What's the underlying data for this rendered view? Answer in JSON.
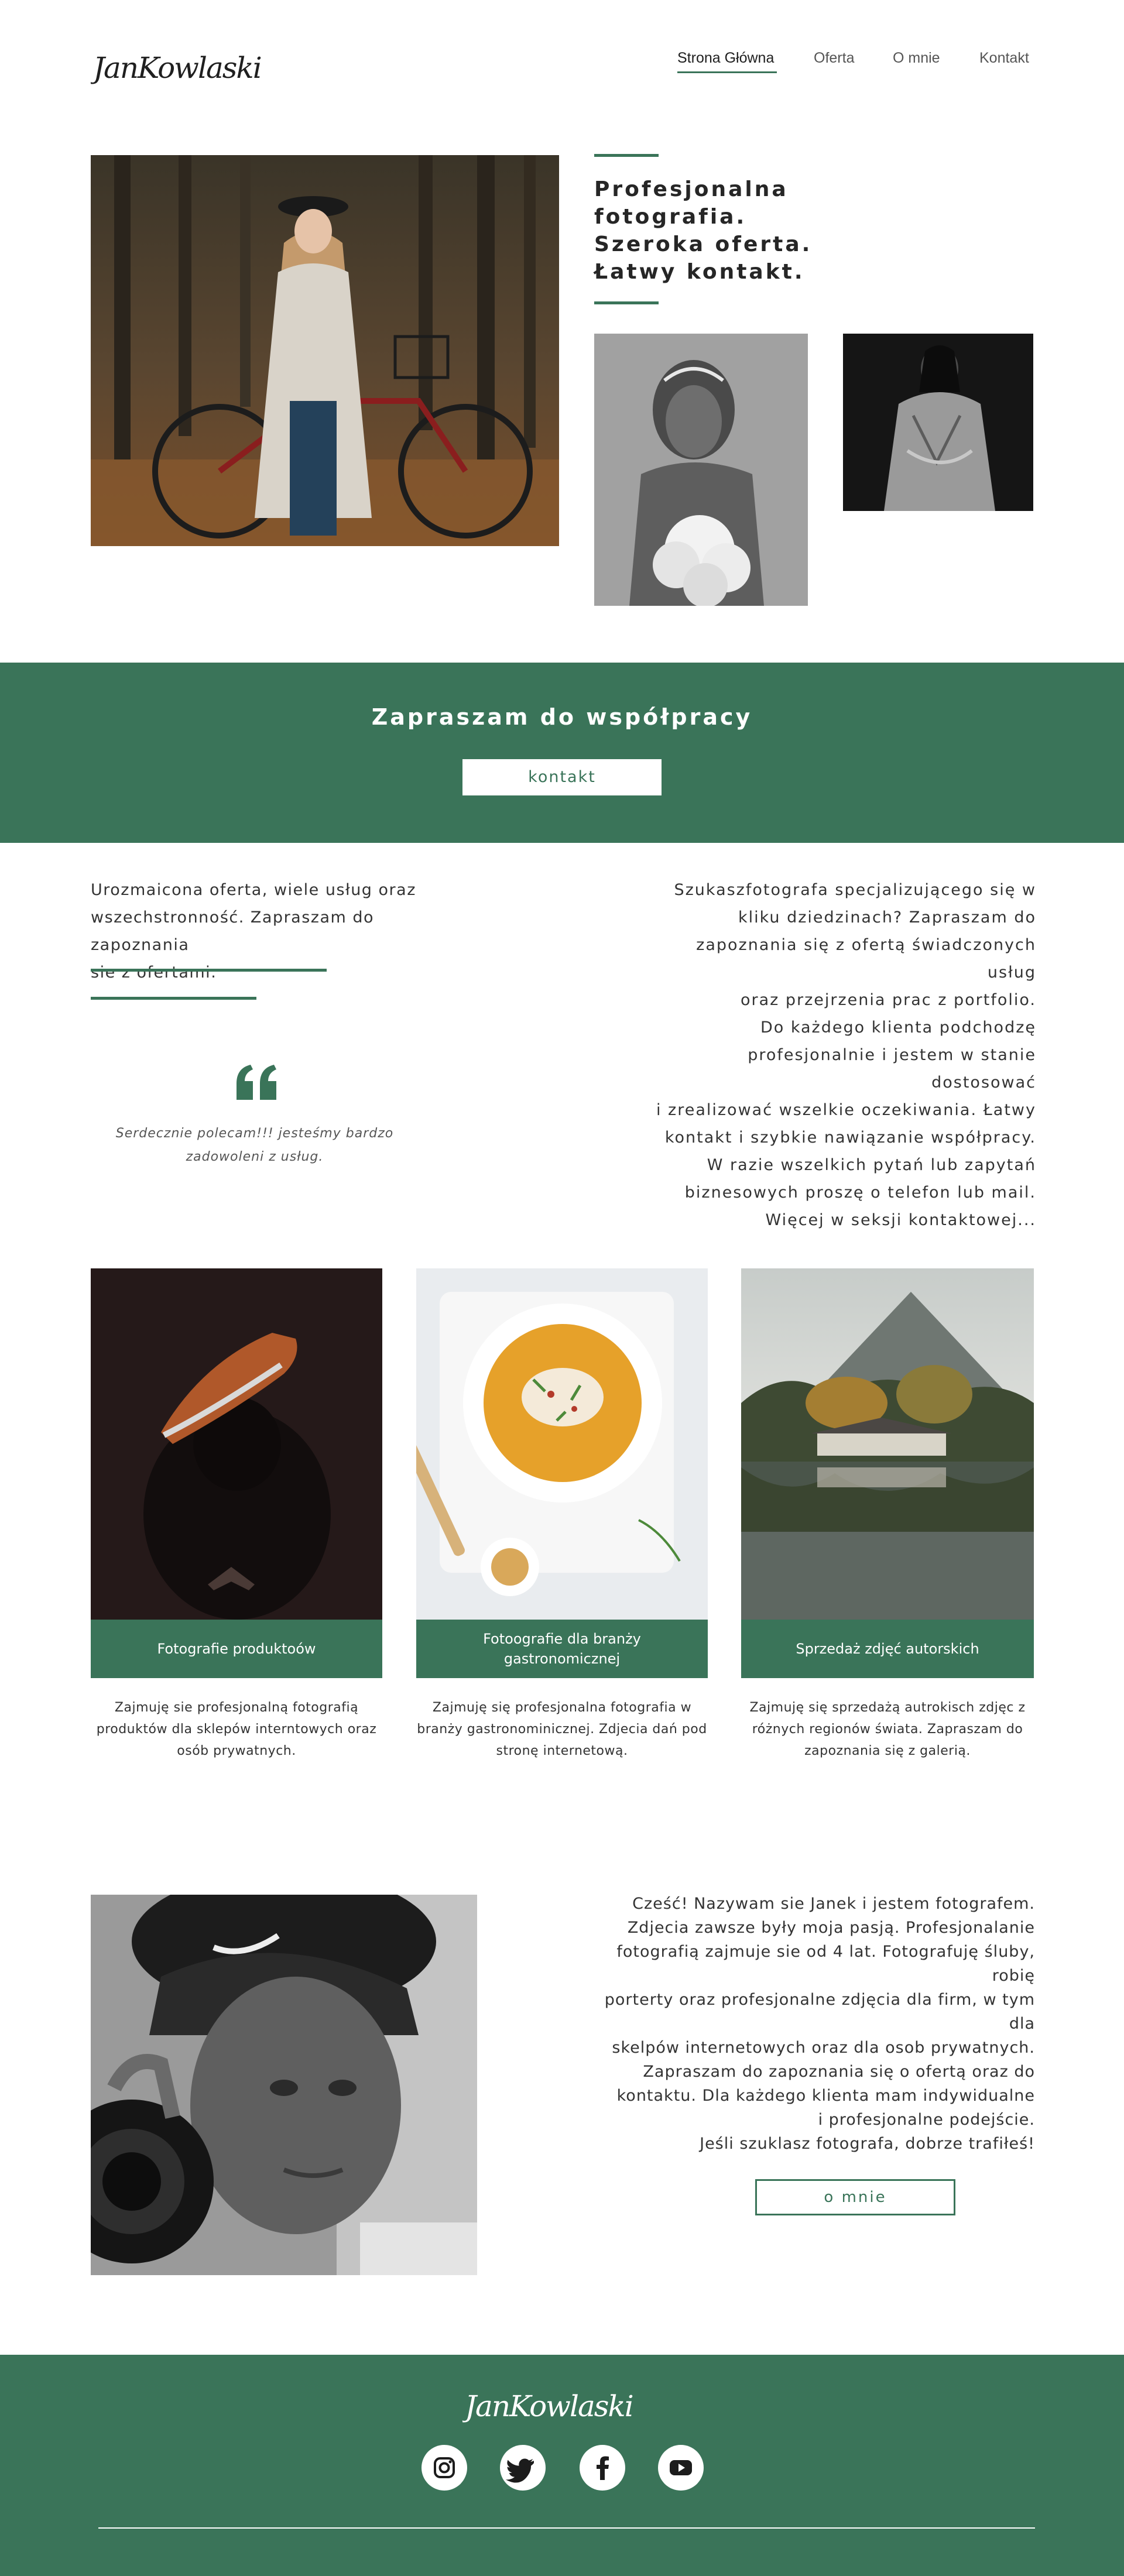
{
  "brand": {
    "logo_text": "JanKowlaski"
  },
  "nav": {
    "items": [
      {
        "label": "Strona Główna",
        "active": true
      },
      {
        "label": "Oferta",
        "active": false
      },
      {
        "label": "O mnie",
        "active": false
      },
      {
        "label": "Kontakt",
        "active": false
      }
    ]
  },
  "hero": {
    "heading_lines": [
      "Profesjonalna",
      "fotografia.",
      "Szeroka oferta.",
      "Łatwy kontakt."
    ]
  },
  "cta_band": {
    "title": "Zapraszam do współpracy",
    "button_label": "kontakt"
  },
  "intro": {
    "left_lines": [
      "Urozmaicona oferta, wiele usług oraz",
      "wszechstronność. Zapraszam do zapoznania",
      "sie z ofertami."
    ],
    "quote_lines": [
      "Serdecznie polecam!!! jesteśmy bardzo",
      "zadowoleni z usług."
    ],
    "right_lines": [
      "Szukaszfotografa specjalizującego się w",
      "kliku dziedzinach? Zapraszam do",
      "zapoznania się z ofertą świadczonych usług",
      "oraz przejrzenia prac z portfolio.",
      "Do każdego klienta podchodzę",
      "profesjonalnie i jestem w stanie dostosować",
      "i zrealizować wszelkie oczekiwania. Łatwy",
      "kontakt i szybkie nawiązanie współpracy.",
      "W razie wszelkich pytań lub zapytań",
      "biznesowych proszę o telefon lub mail.",
      "Więcej w seksji kontaktowej..."
    ]
  },
  "services": [
    {
      "label_lines": [
        "Fotografie produktoów"
      ],
      "desc_lines": [
        "Zajmuję sie profesjonalną fotografią",
        "produktów dla sklepów interntowych oraz",
        "osób prywatnych."
      ]
    },
    {
      "label_lines": [
        "Fotoografie dla branży",
        "gastronomicznej"
      ],
      "desc_lines": [
        "Zajmuję się profesjonalna fotografia w",
        "branży gastronominicznej. Zdjecia dań pod",
        "stronę internetową."
      ]
    },
    {
      "label_lines": [
        "Sprzedaż zdjęć autorskich"
      ],
      "desc_lines": [
        "Zajmuję się sprzedażą autrokisch zdjęc z",
        "różnych regionów świata. Zapraszam do",
        "zapoznania się z galerią."
      ]
    }
  ],
  "about": {
    "lines": [
      "Cześć! Nazywam sie Janek i jestem fotografem.",
      "Zdjecia zawsze były moja pasją. Profesjonalanie",
      "fotografią zajmuje sie od 4 lat. Fotografuję śluby, robię",
      "porterty oraz profesjonalne zdjęcia dla firm, w tym dla",
      "skelpów internetowych oraz dla osob prywatnych.",
      "Zapraszam do zapoznania się o ofertą oraz do",
      "kontaktu. Dla każdego klienta mam indywidualne",
      "i profesjonalne podejście.",
      "Jeśli szuklasz fotografa, dobrze trafiłeś!"
    ],
    "button_label": "o mnie"
  },
  "footer": {
    "logo_text": "JanKowlaski",
    "social_icons": [
      "instagram-icon",
      "twitter-icon",
      "facebook-icon",
      "youtube-icon"
    ]
  },
  "colors": {
    "accent_green": "#3a7459",
    "background": "#ffffff",
    "text": "#2b2b2b"
  }
}
